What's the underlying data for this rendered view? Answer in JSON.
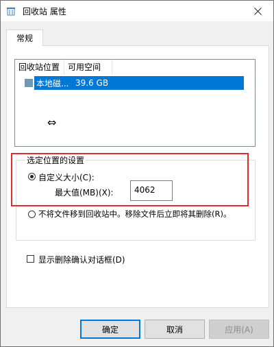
{
  "window": {
    "title": "回收站 属性"
  },
  "tabs": [
    {
      "label": "常规"
    }
  ],
  "list": {
    "headers": [
      "回收站位置",
      "可用空间"
    ],
    "rows": [
      {
        "location": "本地磁...",
        "free_space": "39.6 GB"
      }
    ]
  },
  "settings": {
    "group_label": "选定位置的设置",
    "custom_size_label": "自定义大小(C):",
    "max_value_label": "最大值(MB)(X):",
    "max_value": "4062",
    "no_move_label": "不将文件移到回收站中。移除文件后立即将其删除(R)。"
  },
  "confirm_dialog_label": "显示删除确认对话框(D)",
  "buttons": {
    "ok": "确定",
    "cancel": "取消",
    "apply": "应用(A)"
  },
  "colors": {
    "selection": "#0078d7",
    "highlight_annotation": "#e32b2b"
  }
}
